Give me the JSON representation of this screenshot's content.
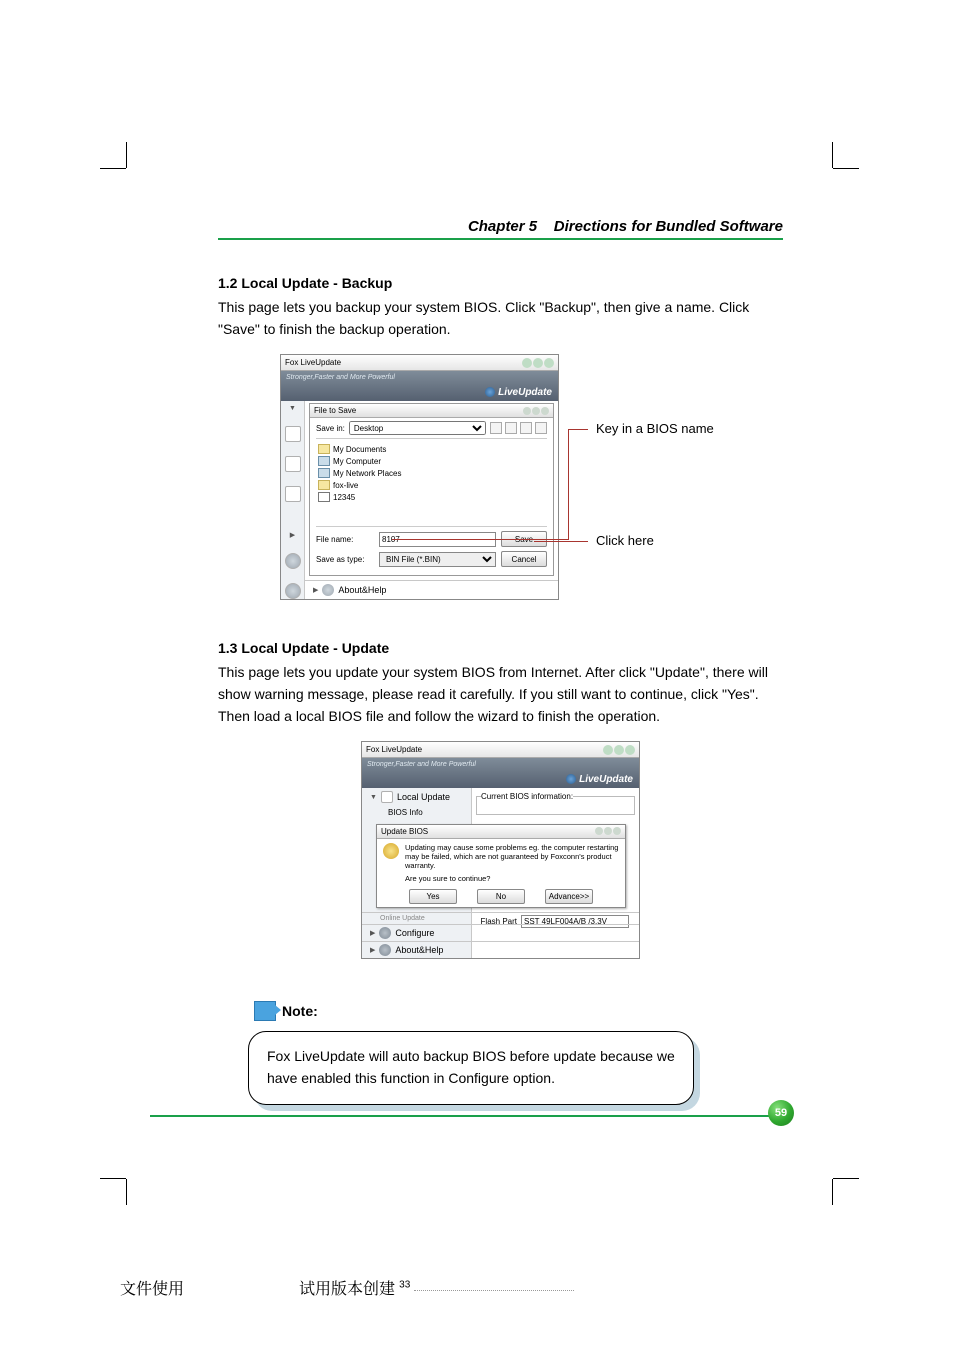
{
  "header": {
    "chapter": "Chapter 5",
    "title": "Directions for Bundled Software"
  },
  "section12": {
    "title": "1.2 Local Update - Backup",
    "body": "This page lets you backup your system BIOS. Click \"Backup\", then give a name. Click \"Save\" to finish the backup operation."
  },
  "fig1": {
    "app_title": "Fox LiveUpdate",
    "banner_tag": "Stronger,Faster and More Powerful",
    "brand": "LiveUpdate",
    "save_dialog": {
      "title": "File to Save",
      "save_in_label": "Save in:",
      "save_in_value": "Desktop",
      "items": [
        "My Documents",
        "My Computer",
        "My Network Places",
        "fox-live",
        "12345"
      ],
      "filename_label": "File name:",
      "filename_value": "8107",
      "save_label": "Save",
      "savetype_label": "Save as type:",
      "savetype_value": "BIN File (*.BIN)",
      "cancel_label": "Cancel"
    },
    "about_label": "About&Help",
    "annot1": "Key in a BIOS name",
    "annot2": "Click here"
  },
  "section13": {
    "title": "1.3 Local Update - Update",
    "body": "This page lets you update your system BIOS from Internet. After click \"Update\", there will show warning message, please read it carefully. If you still want to continue, click \"Yes\". Then load a local BIOS file and follow the wizard to finish the operation."
  },
  "fig2": {
    "app_title": "Fox LiveUpdate",
    "banner_tag": "Stronger,Faster and More Powerful",
    "brand": "LiveUpdate",
    "side": {
      "local_update": "Local Update",
      "bios_info": "BIOS Info"
    },
    "current_bios_legend": "Current BIOS information:",
    "update_dialog": {
      "title": "Update BIOS",
      "msg": "Updating may cause some problems eg. the computer restarting may be failed, which are not guaranteed by Foxconn's product warranty.",
      "confirm": "Are you sure to continue?",
      "yes": "Yes",
      "no": "No",
      "advance": "Advance>>"
    },
    "online_update": "Online Update",
    "flash_part_label": "Flash Part",
    "flash_part_value": "SST 49LF004A/B /3.3V",
    "configure": "Configure",
    "about": "About&Help"
  },
  "note": {
    "label": "Note:",
    "body": "Fox LiveUpdate will auto backup BIOS before update because we have enabled this function in Configure option."
  },
  "page_number": "59",
  "footer": {
    "left": "文件使用",
    "mid": "试用版本创建",
    "sup": "33"
  }
}
